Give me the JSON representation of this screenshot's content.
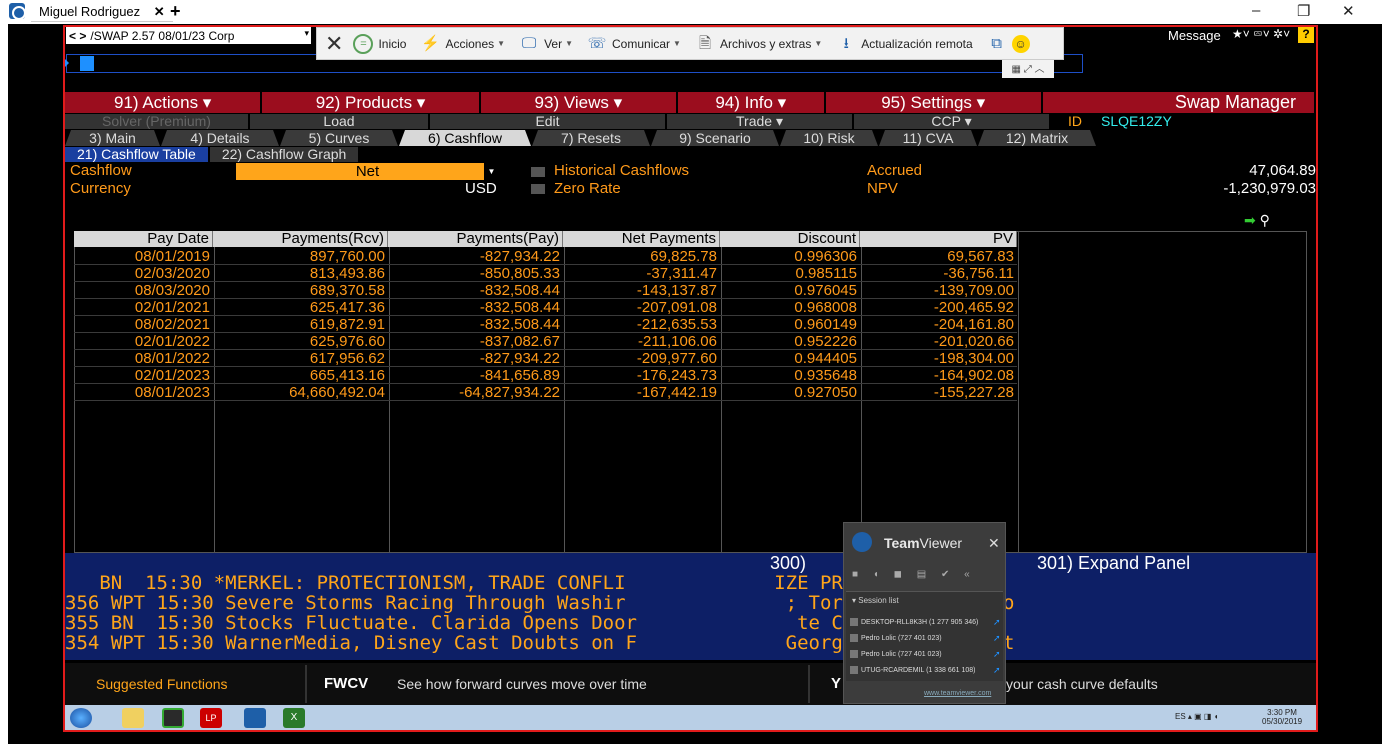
{
  "window": {
    "tab_title": "Miguel Rodriguez",
    "tab_close": "✕",
    "tab_add": "+",
    "minimize": "–",
    "restore": "❐",
    "close": "✕"
  },
  "terminal": {
    "nav_arrows": "< >",
    "security": "/SWAP 2.57 08/01/23 Corp",
    "message_label": "Message",
    "help": "?"
  },
  "teamviewer_toolbar": {
    "close": "✕",
    "items": [
      {
        "label": "Inicio",
        "icon": "home-icon"
      },
      {
        "label": "Acciones",
        "icon": "lightning-icon"
      },
      {
        "label": "Ver",
        "icon": "monitor-icon"
      },
      {
        "label": "Comunicar",
        "icon": "phone-icon"
      },
      {
        "label": "Archivos y extras",
        "icon": "files-icon"
      },
      {
        "label": "Actualización remota",
        "icon": "download-icon"
      }
    ]
  },
  "menubar": [
    {
      "label": "91) Actions ▾",
      "width": 196
    },
    {
      "label": "92) Products ▾",
      "width": 217
    },
    {
      "label": "93) Views ▾",
      "width": 196
    },
    {
      "label": "94) Info ▾",
      "width": 146
    },
    {
      "label": "95) Settings ▾",
      "width": 216
    },
    {
      "label": "Swap Manager",
      "width": 272
    }
  ],
  "funcrow": {
    "solver": "Solver (Premium)",
    "load": "Load",
    "edit": "Edit",
    "trade": "Trade ▾",
    "ccp": "CCP ▾",
    "id_label": "ID",
    "id_value": "SLQE12ZY"
  },
  "tabs": [
    {
      "label": "3) Main",
      "w": 95
    },
    {
      "label": "4) Details",
      "w": 118
    },
    {
      "label": "5) Curves",
      "w": 118
    },
    {
      "label": "6) Cashflow",
      "w": 132,
      "active": true
    },
    {
      "label": "7) Resets",
      "w": 118
    },
    {
      "label": "9) Scenario",
      "w": 128
    },
    {
      "label": "10) Risk",
      "w": 98
    },
    {
      "label": "11) CVA",
      "w": 98
    },
    {
      "label": "12) Matrix",
      "w": 118
    }
  ],
  "subtabs": [
    {
      "label": "21) Cashflow Table",
      "active": true
    },
    {
      "label": "22) Cashflow Graph",
      "active": false
    }
  ],
  "settings": {
    "cashflow_label": "Cashflow",
    "cashflow_value": "Net",
    "currency_label": "Currency",
    "currency_value": "USD",
    "historical_label": "Historical Cashflows",
    "zero_rate_label": "Zero Rate",
    "accrued_label": "Accrued",
    "accrued_value": "47,064.89",
    "npv_label": "NPV",
    "npv_value": "-1,230,979.03"
  },
  "table": {
    "columns": [
      "Pay Date",
      "Payments(Rcv)",
      "Payments(Pay)",
      "Net Payments",
      "Discount",
      "PV"
    ],
    "rows": [
      [
        "08/01/2019",
        "897,760.00",
        "-827,934.22",
        "69,825.78",
        "0.996306",
        "69,567.83"
      ],
      [
        "02/03/2020",
        "813,493.86",
        "-850,805.33",
        "-37,311.47",
        "0.985115",
        "-36,756.11"
      ],
      [
        "08/03/2020",
        "689,370.58",
        "-832,508.44",
        "-143,137.87",
        "0.976045",
        "-139,709.00"
      ],
      [
        "02/01/2021",
        "625,417.36",
        "-832,508.44",
        "-207,091.08",
        "0.968008",
        "-200,465.92"
      ],
      [
        "08/02/2021",
        "619,872.91",
        "-832,508.44",
        "-212,635.53",
        "0.960149",
        "-204,161.80"
      ],
      [
        "02/01/2022",
        "625,976.60",
        "-837,082.67",
        "-211,106.06",
        "0.952226",
        "-201,020.66"
      ],
      [
        "08/01/2022",
        "617,956.62",
        "-827,934.22",
        "-209,977.60",
        "0.944405",
        "-198,304.00"
      ],
      [
        "02/01/2023",
        "665,413.16",
        "-841,656.89",
        "-176,243.73",
        "0.935648",
        "-164,902.08"
      ],
      [
        "08/01/2023",
        "64,660,492.04",
        "-64,827,934.22",
        "-167,442.19",
        "0.927050",
        "-155,227.28"
      ]
    ]
  },
  "news": {
    "hdr_left": "300)",
    "hdr_right": "301) Expand Panel",
    "lines": [
      "   BN  15:30 *MERKEL: PROTECTIONISM, TRADE CONFLI             IZE PROSPERITY",
      "356 WPT 15:30 Severe Storms Racing Through Washir              ; Tornado Warning fo",
      "355 BN  15:30 Stocks Fluctuate. Clarida Opens Door              te Cut: Daybreak",
      "354 WPT 15:30 WarnerMedia, Disney Cast Doubts on F             Georgia If New Abort"
    ]
  },
  "suggested": {
    "label": "Suggested Functions",
    "fwcv": "FWCV",
    "fwcv_desc": "See how forward curves move over time",
    "y": "Y",
    "cash_desc": "your cash curve defaults"
  },
  "taskbar": {
    "tray": "ES  ▴  ▣  ◨  ◖",
    "time": "3:30 PM",
    "date": "05/30/2019"
  },
  "tvpanel": {
    "title_bold": "Team",
    "title_rest": "Viewer",
    "close": "✕",
    "list_header": "▾ Session list",
    "sessions": [
      "DESKTOP-RLL8K3H (1 277 905 346)",
      "Pedro Lolic (727 401 023)",
      "Pedro Lolic (727 401 023)",
      "UTUG-RCARDEMIL (1 338 661 108)"
    ],
    "link": "www.teamviewer.com"
  },
  "colors": {
    "menu_red": "#9b0d1e",
    "bbg_orange": "#ff9a1a",
    "news_blue": "#0d1f66",
    "frame_red": "#e11b1b"
  }
}
